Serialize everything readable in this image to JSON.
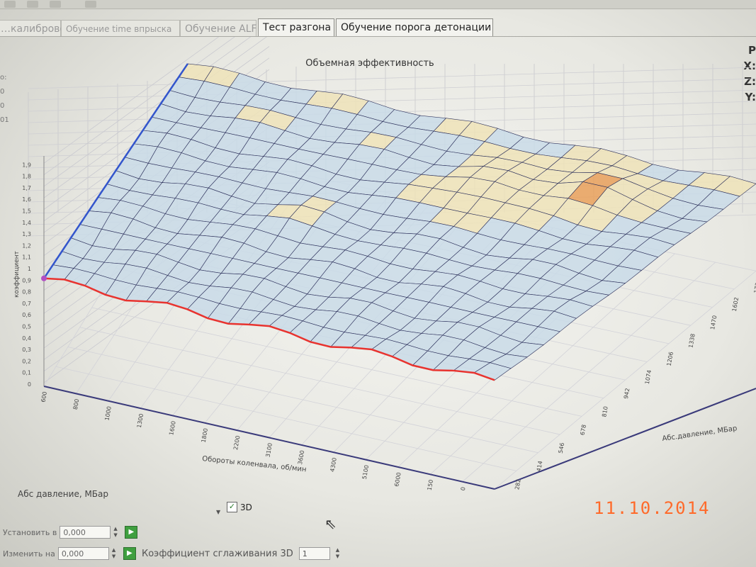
{
  "tabs": [
    {
      "label": "…калибровок",
      "state": "faded"
    },
    {
      "label": "Обучение time впрыска",
      "state": "faded"
    },
    {
      "label": "Обучение ALF",
      "state": "faded"
    },
    {
      "label": "Тест разгона",
      "state": "normal"
    },
    {
      "label": "Обучение порога детонации",
      "state": "normal"
    }
  ],
  "side_right": [
    "P",
    "X:",
    "Z:",
    "Y:"
  ],
  "side_left": [
    "о:",
    "0",
    "0",
    "01"
  ],
  "chart_data": {
    "type": "surface",
    "title": "Объемная эффективность",
    "ylabel": "коэффициент",
    "xlabel": "Обороты коленвала, об/мин",
    "zlabel": "Абс.давление, МБар",
    "y_ticks": [
      "0",
      "0,1",
      "0,2",
      "0,3",
      "0,4",
      "0,5",
      "0,6",
      "0,7",
      "0,8",
      "0,9",
      "1",
      "1,1",
      "1,2",
      "1,3",
      "1,4",
      "1,5",
      "1,6",
      "1,7",
      "1,8",
      "1,9"
    ],
    "x_ticks": [
      "600",
      "800",
      "1000",
      "1300",
      "1600",
      "1800",
      "2200",
      "3100",
      "3600",
      "4300",
      "5100",
      "6000",
      "7150",
      "8000",
      "9000"
    ],
    "z_ticks": [
      "150",
      "282",
      "414",
      "546",
      "678",
      "810",
      "942",
      "1074",
      "1206",
      "1338",
      "1470",
      "1602",
      "1734"
    ],
    "colors": {
      "base": "#c9dbe8",
      "mid": "#efe3b8",
      "peak": "#e9a05a",
      "edge_red": "#e8332f",
      "edge_blue": "#3355cc",
      "grid": "#9aa0b8"
    }
  },
  "bottom": {
    "abs_label": "Абс давление, МБар",
    "check_3d_label": "3D",
    "set_label": "Установить в",
    "set_value": "0,000",
    "change_label": "Изменить на",
    "change_value": "0,000",
    "smooth_label": "Коэффициент сглаживания 3D",
    "smooth_value": "1"
  },
  "date_stamp": "11.10.2014"
}
